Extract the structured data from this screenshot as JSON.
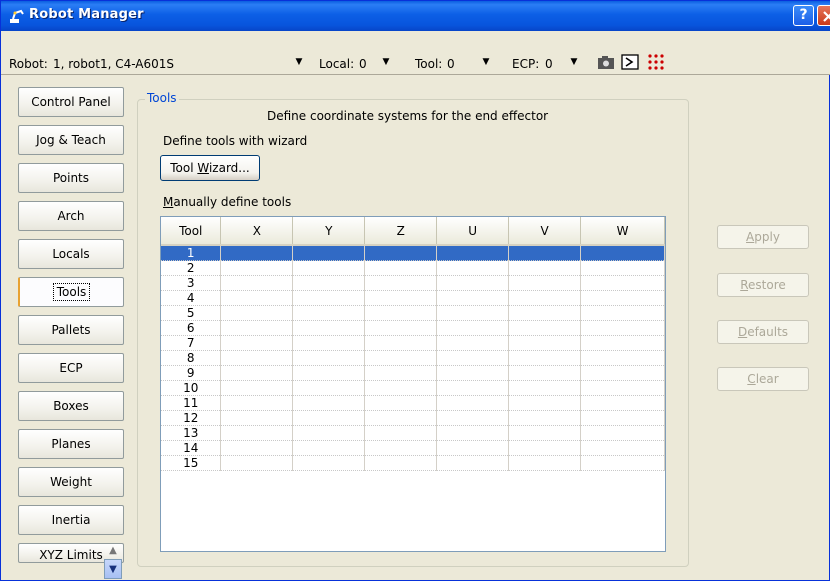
{
  "window": {
    "title": "Robot Manager",
    "help_label": "?"
  },
  "toolbar": {
    "robot_label": "Robot:",
    "robot_value": "1, robot1, C4-A601S",
    "local_label": "Local:",
    "local_value": "0",
    "tool_label": "Tool:",
    "tool_value": "0",
    "ecp_label": "ECP:",
    "ecp_value": "0"
  },
  "tabs": [
    {
      "label": "Control Panel"
    },
    {
      "label": "Jog & Teach"
    },
    {
      "label": "Points"
    },
    {
      "label": "Arch"
    },
    {
      "label": "Locals"
    },
    {
      "label": "Tools"
    },
    {
      "label": "Pallets"
    },
    {
      "label": "ECP"
    },
    {
      "label": "Boxes"
    },
    {
      "label": "Planes"
    },
    {
      "label": "Weight"
    },
    {
      "label": "Inertia"
    },
    {
      "label": "XYZ Limits"
    }
  ],
  "active_tab": "Tools",
  "tools_panel": {
    "group_title": "Tools",
    "description": "Define coordinate systems for the end effector",
    "wizard_label": "Define tools with wizard",
    "wizard_button_pre": "Tool ",
    "wizard_button_mnemonic": "W",
    "wizard_button_post": "izard...",
    "manual_label_mnemonic": "M",
    "manual_label_rest": "anually define tools"
  },
  "grid": {
    "columns": [
      "Tool",
      "X",
      "Y",
      "Z",
      "U",
      "V",
      "W"
    ],
    "rows": [
      "1",
      "2",
      "3",
      "4",
      "5",
      "6",
      "7",
      "8",
      "9",
      "10",
      "11",
      "12",
      "13",
      "14",
      "15"
    ],
    "selected_row": "1"
  },
  "actions": {
    "apply": {
      "mnemonic": "A",
      "rest": "pply"
    },
    "restore": {
      "mnemonic": "R",
      "rest": "estore"
    },
    "defaults": {
      "mnemonic": "D",
      "rest": "efaults"
    },
    "clear": {
      "mnemonic": "C",
      "rest": "lear"
    }
  },
  "colors": {
    "titlebar": "#0a5ee0",
    "selection": "#316ac5",
    "group_title": "#0046d5",
    "disabled_text": "#aca899"
  },
  "icons": [
    "robot-icon",
    "help-icon",
    "close-icon",
    "dropdown-arrow-icon",
    "camera-icon",
    "command-window-icon",
    "io-monitor-icon",
    "scroll-up-icon",
    "scroll-down-icon"
  ]
}
